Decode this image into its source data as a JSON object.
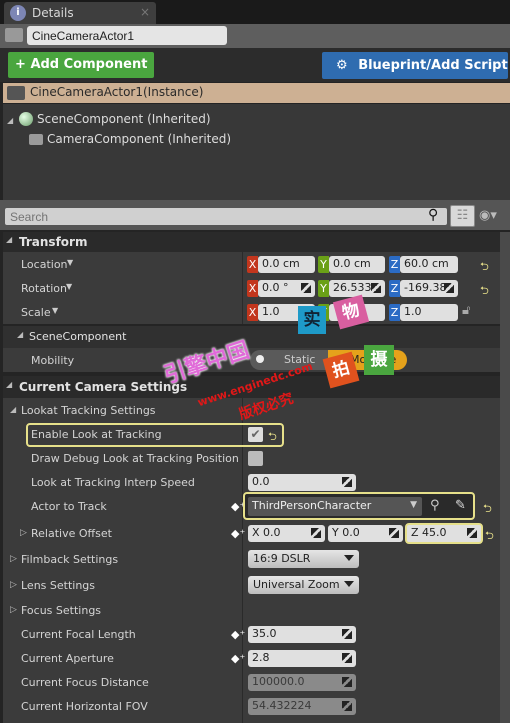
{
  "tab": {
    "icon": "info-icon",
    "label": "Details",
    "close": "×"
  },
  "actor_name": "CineCameraActor1",
  "toolbar": {
    "add_component": "Add Component",
    "blueprint": "Blueprint/Add Script"
  },
  "instance_label": "CineCameraActor1(Instance)",
  "tree": [
    {
      "label": "SceneComponent (Inherited)",
      "icon": "scene-component-icon"
    },
    {
      "label": "CameraComponent (Inherited)",
      "icon": "camera-icon"
    }
  ],
  "search": {
    "placeholder": "Search"
  },
  "transform": {
    "title": "Transform",
    "location": {
      "label": "Location",
      "x": "0.0 cm",
      "y": "0.0 cm",
      "z": "60.0 cm"
    },
    "rotation": {
      "label": "Rotation",
      "x": "0.0 °",
      "y": "26.533",
      "z": "-169.38"
    },
    "scale": {
      "label": "Scale",
      "x": "1.0",
      "y": "1.0",
      "z": "1.0"
    },
    "axis": {
      "x": "X",
      "y": "Y",
      "z": "Z"
    }
  },
  "scene_component": {
    "title": "SceneComponent",
    "mobility_label": "Mobility",
    "mobility_options": [
      "Static",
      "Movable"
    ],
    "selected": "Movable"
  },
  "camera": {
    "title": "Current Camera Settings",
    "lookat_title": "Lookat Tracking Settings",
    "enable_look": "Enable Look at Tracking",
    "enable_look_checked": true,
    "draw_debug": "Draw Debug Look at Tracking Position",
    "draw_debug_checked": false,
    "interp_label": "Look at Tracking Interp Speed",
    "interp_value": "0.0",
    "actor_label": "Actor to Track",
    "actor_value": "ThirdPersonCharacter",
    "offset_label": "Relative Offset",
    "offset": {
      "x": "0.0",
      "y": "0.0",
      "z": "45.0"
    },
    "filmback_label": "Filmback Settings",
    "filmback_value": "16:9 DSLR",
    "lens_label": "Lens Settings",
    "lens_value": "Universal Zoom",
    "focus_label": "Focus Settings",
    "focal_label": "Current Focal Length",
    "focal_value": "35.0",
    "aperture_label": "Current Aperture",
    "aperture_value": "2.8",
    "focus_dist_label": "Current Focus Distance",
    "focus_dist_value": "100000.0",
    "fov_label": "Current Horizontal FOV",
    "fov_value": "54.432224"
  },
  "watermark": {
    "line1": "引擎中国",
    "line2": "www.enginedc.com",
    "line3": "版权必究",
    "tiles": [
      "实",
      "物",
      "拍",
      "摄"
    ]
  }
}
